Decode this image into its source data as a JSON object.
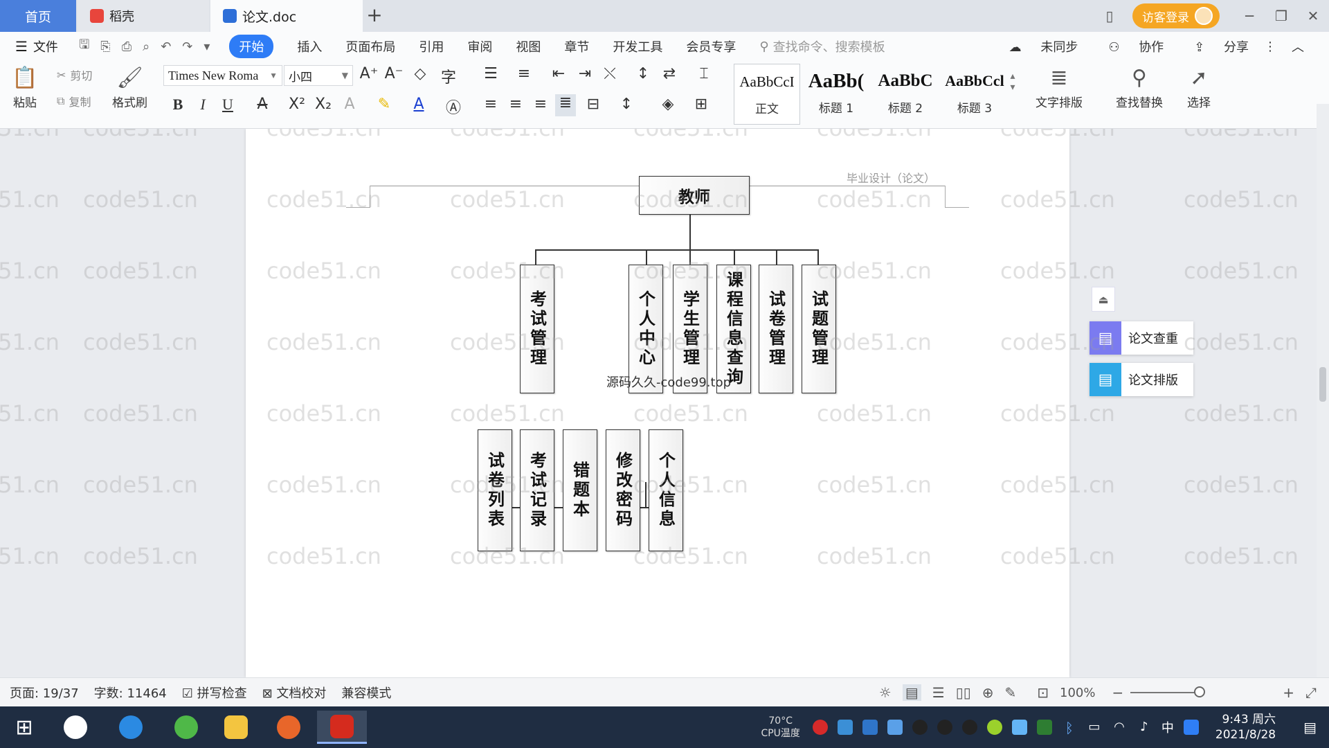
{
  "tabs": {
    "home": "首页",
    "daoke": "稻壳",
    "doc": "论文.doc",
    "add": "+",
    "guest_login": "访客登录"
  },
  "menu": {
    "file": "文件",
    "start": "开始",
    "items": [
      "插入",
      "页面布局",
      "引用",
      "审阅",
      "视图",
      "章节",
      "开发工具",
      "会员专享"
    ],
    "search": "查找命令、搜索模板",
    "unsynced": "未同步",
    "collab": "协作",
    "share": "分享"
  },
  "toolbar": {
    "paste": "粘贴",
    "cut": "剪切",
    "copy": "复制",
    "format_painter": "格式刷",
    "font_name": "Times New Roma",
    "font_size": "小四",
    "styles": [
      {
        "sample": "AaBbCcI",
        "label": "正文"
      },
      {
        "sample": "AaBb(",
        "label": "标题 1"
      },
      {
        "sample": "AaBbC",
        "label": "标题 2"
      },
      {
        "sample": "AaBbCcl",
        "label": "标题 3"
      }
    ],
    "text_layout": "文字排版",
    "find_replace": "查找替换",
    "select": "选择"
  },
  "document": {
    "header": "毕业设计（论文）",
    "overlay_watermark": "源码久久-code99.top",
    "watermark": "code51.cn",
    "chart": {
      "root": "教师",
      "level1": [
        "考试管理",
        "个人中心",
        "学生管理",
        "课程信息查询",
        "试卷管理",
        "试题管理"
      ],
      "level2_exam": [
        "试卷列表",
        "考试记录",
        "错题本"
      ],
      "level2_personal": [
        "修改密码",
        "个人信息"
      ]
    }
  },
  "side_panel": {
    "check": "论文查重",
    "layout": "论文排版"
  },
  "status": {
    "page": "页面: 19/37",
    "words": "字数: 11464",
    "spell": "拼写检查",
    "proofread": "文档校对",
    "compat": "兼容模式",
    "zoom": "100%"
  },
  "taskbar": {
    "cpu_temp": "70°C",
    "cpu_label": "CPU温度",
    "ime": "中",
    "time": "9:43 周六",
    "date": "2021/8/28"
  },
  "colors": {
    "accent": "#2e7cf6",
    "home_tab": "#4a7fdc",
    "guest": "#f5a623",
    "taskbar": "#1f2d42"
  }
}
